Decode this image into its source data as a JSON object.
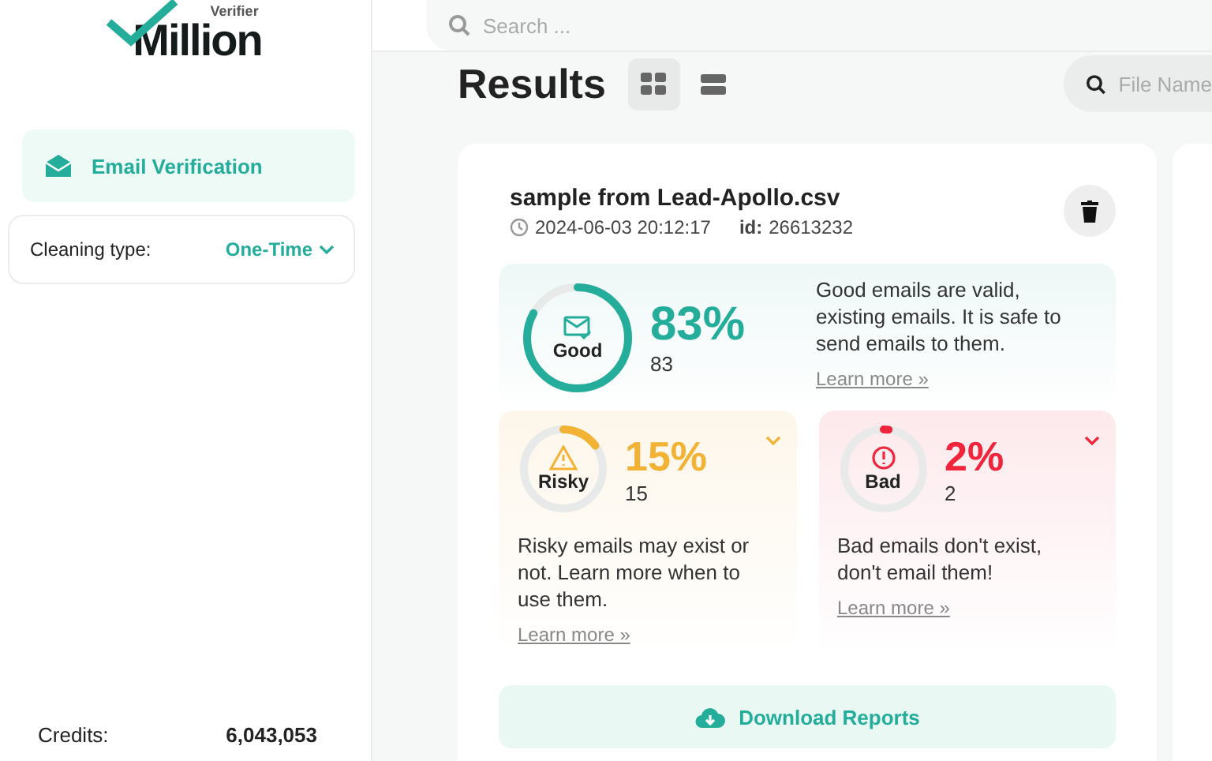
{
  "logo": {
    "small": "Verifier",
    "big": "Million"
  },
  "sidebar": {
    "nav": [
      {
        "label": "Email Verification",
        "selected": true
      }
    ],
    "cleaning": {
      "label": "Cleaning type:",
      "value": "One-Time"
    },
    "credits": {
      "label": "Credits:",
      "value": "6,043,053"
    }
  },
  "search": {
    "placeholder": "Search ..."
  },
  "results": {
    "title": "Results",
    "views": [
      {
        "kind": "grid",
        "selected": true
      },
      {
        "kind": "list",
        "selected": false
      }
    ],
    "file_search": {
      "placeholder": "File Name"
    }
  },
  "card": {
    "file": "sample from Lead-Apollo.csv",
    "date": "2024-06-03 20:12:17",
    "id_label": "id:",
    "id": "26613232",
    "stats": [
      {
        "kind": "good",
        "label": "Good",
        "percent": "83%",
        "count": "83",
        "level": 0.83,
        "text": "Good emails are valid, existing emails. It is safe to send emails to them.",
        "link": "Learn more »"
      },
      {
        "kind": "risky",
        "label": "Risky",
        "percent": "15%",
        "count": "15",
        "level": 0.15,
        "text": "Risky emails may exist or not. Learn more when to use them.",
        "link": "Learn more »"
      },
      {
        "kind": "bad",
        "label": "Bad",
        "percent": "2%",
        "count": "2",
        "level": 0.02,
        "text": "Bad emails don't exist, don't email them!",
        "link": "Learn more »"
      }
    ],
    "download": "Download Reports"
  }
}
